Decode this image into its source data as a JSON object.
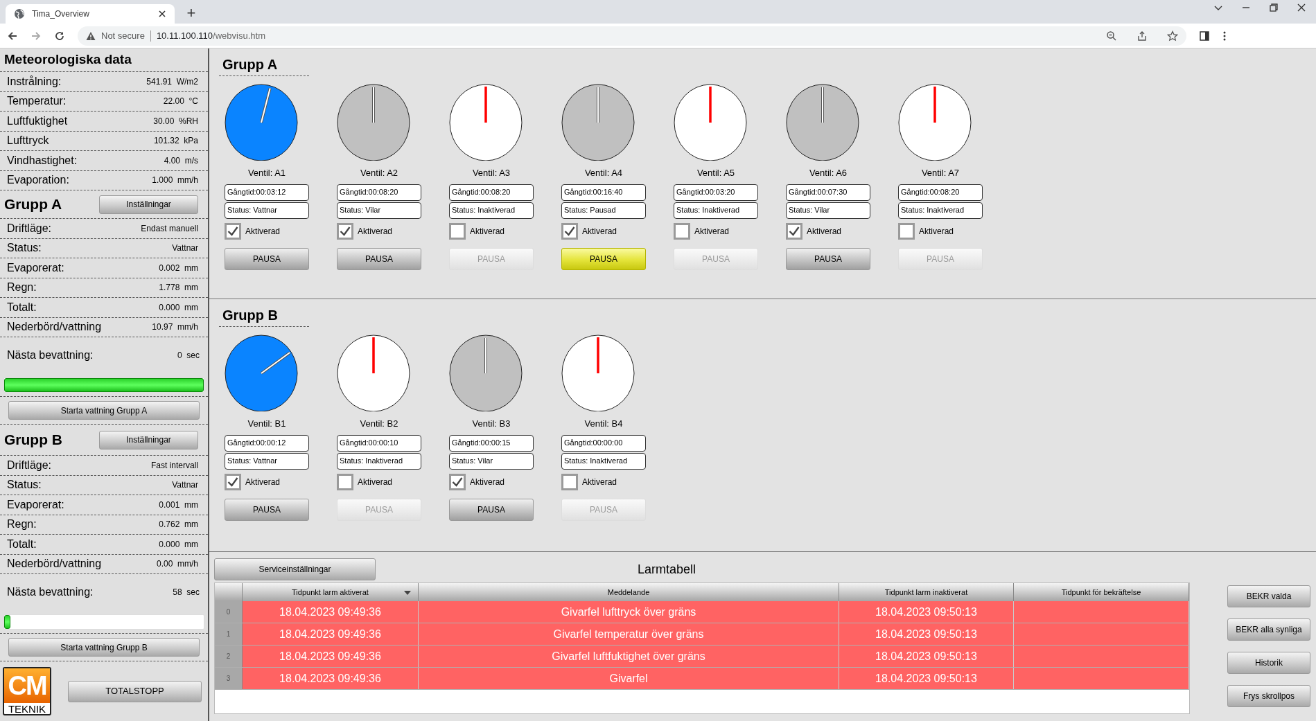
{
  "browser": {
    "tab_title": "Tima_Overview",
    "new_tab": "+",
    "url_warning": "Not secure",
    "url_host": "10.11.100.110",
    "url_path": "/webvisu.htm"
  },
  "sidebar": {
    "title": "Meteorologiska data",
    "meteo": [
      {
        "label": "Instrålning:",
        "value": "541.91",
        "unit": "W/m2"
      },
      {
        "label": "Temperatur:",
        "value": "22.00",
        "unit": "°C"
      },
      {
        "label": "Luftfuktighet",
        "value": "30.00",
        "unit": "%RH"
      },
      {
        "label": "Lufttryck",
        "value": "101.32",
        "unit": "kPa"
      },
      {
        "label": "Vindhastighet:",
        "value": "4.00",
        "unit": "m/s"
      },
      {
        "label": "Evaporation:",
        "value": "1.000",
        "unit": "mm/h"
      }
    ],
    "groups": [
      {
        "title": "Grupp A",
        "settings_button": "Inställningar",
        "rows": [
          {
            "label": "Driftläge:",
            "value": "Endast manuell"
          },
          {
            "label": "Status:",
            "value": "Vattnar"
          },
          {
            "label": "Evaporerat:",
            "value": "0.002",
            "unit": "mm"
          },
          {
            "label": "Regn:",
            "value": "1.778",
            "unit": "mm"
          },
          {
            "label": "Totalt:",
            "value": "0.000",
            "unit": "mm"
          },
          {
            "label": "Nederbörd/vattning",
            "value": "10.97",
            "unit": "mm/h"
          }
        ],
        "next_label": "Nästa bevattning:",
        "next_value": "0",
        "next_unit": "sec",
        "progress": {
          "level": 1
        },
        "start_button": "Starta vattning Grupp A"
      },
      {
        "title": "Grupp B",
        "settings_button": "Inställningar",
        "rows": [
          {
            "label": "Driftläge:",
            "value": "Fast intervall"
          },
          {
            "label": "Status:",
            "value": "Vattnar"
          },
          {
            "label": "Evaporerat:",
            "value": "0.001",
            "unit": "mm"
          },
          {
            "label": "Regn:",
            "value": "0.762",
            "unit": "mm"
          },
          {
            "label": "Totalt:",
            "value": "0.000",
            "unit": "mm"
          },
          {
            "label": "Nederbörd/vattning",
            "value": "0.00",
            "unit": "mm/h"
          }
        ],
        "next_label": "Nästa bevattning:",
        "next_value": "58",
        "next_unit": "sec",
        "progress": {
          "level": 0.03
        },
        "start_button": "Starta vattning Grupp B"
      }
    ],
    "logo": {
      "top": "CM",
      "bottom": "TEKNIK"
    },
    "totalstopp_button": "TOTALSTOPP"
  },
  "main": {
    "groups": [
      {
        "title": "Grupp A",
        "valves": [
          {
            "kind": "running",
            "level": 0.04,
            "name": "Ventil: A1",
            "runtime": "Gångtid:00:03:12",
            "status": "Status: Vattnar",
            "checked": true,
            "checkbox_label": "Aktiverad",
            "pause_label": "PAUSA",
            "pause_disabled": false,
            "paused": false
          },
          {
            "kind": "idle",
            "name": "Ventil: A2",
            "runtime": "Gångtid:00:08:20",
            "status": "Status: Vilar",
            "checked": true,
            "checkbox_label": "Aktiverad",
            "pause_label": "PAUSA",
            "pause_disabled": false,
            "paused": false
          },
          {
            "kind": "inactive",
            "name": "Ventil: A3",
            "runtime": "Gångtid:00:08:20",
            "status": "Status: Inaktiverad",
            "checked": false,
            "checkbox_label": "Aktiverad",
            "pause_label": "PAUSA",
            "pause_disabled": true,
            "paused": false
          },
          {
            "kind": "idle",
            "name": "Ventil: A4",
            "runtime": "Gångtid:00:16:40",
            "status": "Status: Pausad",
            "checked": true,
            "checkbox_label": "Aktiverad",
            "pause_label": "PAUSA",
            "pause_disabled": false,
            "paused": true
          },
          {
            "kind": "inactive",
            "name": "Ventil: A5",
            "runtime": "Gångtid:00:03:20",
            "status": "Status: Inaktiverad",
            "checked": false,
            "checkbox_label": "Aktiverad",
            "pause_label": "PAUSA",
            "pause_disabled": true,
            "paused": false
          },
          {
            "kind": "idle",
            "name": "Ventil: A6",
            "runtime": "Gångtid:00:07:30",
            "status": "Status: Vilar",
            "checked": true,
            "checkbox_label": "Aktiverad",
            "pause_label": "PAUSA",
            "pause_disabled": false,
            "paused": false
          },
          {
            "kind": "inactive",
            "name": "Ventil: A7",
            "runtime": "Gångtid:00:08:20",
            "status": "Status: Inaktiverad",
            "checked": false,
            "checkbox_label": "Aktiverad",
            "pause_label": "PAUSA",
            "pause_disabled": true,
            "paused": false
          }
        ]
      },
      {
        "title": "Grupp B",
        "valves": [
          {
            "kind": "running",
            "level": 0.15,
            "name": "Ventil: B1",
            "runtime": "Gångtid:00:00:12",
            "status": "Status: Vattnar",
            "checked": true,
            "checkbox_label": "Aktiverad",
            "pause_label": "PAUSA",
            "pause_disabled": false,
            "paused": false
          },
          {
            "kind": "inactive",
            "name": "Ventil: B2",
            "runtime": "Gångtid:00:00:10",
            "status": "Status: Inaktiverad",
            "checked": false,
            "checkbox_label": "Aktiverad",
            "pause_label": "PAUSA",
            "pause_disabled": true,
            "paused": false
          },
          {
            "kind": "idle",
            "name": "Ventil: B3",
            "runtime": "Gångtid:00:00:15",
            "status": "Status: Vilar",
            "checked": true,
            "checkbox_label": "Aktiverad",
            "pause_label": "PAUSA",
            "pause_disabled": false,
            "paused": false
          },
          {
            "kind": "inactive",
            "name": "Ventil: B4",
            "runtime": "Gångtid:00:00:00",
            "status": "Status: Inaktiverad",
            "checked": false,
            "checkbox_label": "Aktiverad",
            "pause_label": "PAUSA",
            "pause_disabled": true,
            "paused": false
          }
        ]
      }
    ]
  },
  "alarms": {
    "service_button": "Serviceinställningar",
    "title": "Larmtabell",
    "columns": [
      {
        "label": "Tidpunkt larm aktiverat",
        "sorted": true
      },
      {
        "label": "Meddelande",
        "sorted": false
      },
      {
        "label": "Tidpunkt larm inaktiverat",
        "sorted": false
      },
      {
        "label": "Tidpunkt för bekräftelse",
        "sorted": false
      }
    ],
    "rows": [
      {
        "index": "0",
        "cells": [
          "18.04.2023 09:49:36",
          "Givarfel lufttryck över gräns",
          "18.04.2023 09:50:13"
        ]
      },
      {
        "index": "1",
        "cells": [
          "18.04.2023 09:49:36",
          "Givarfel temperatur över gräns",
          "18.04.2023 09:50:13"
        ]
      },
      {
        "index": "2",
        "cells": [
          "18.04.2023 09:49:36",
          "Givarfel luftfuktighet över gräns",
          "18.04.2023 09:50:13"
        ]
      },
      {
        "index": "3",
        "cells": [
          "18.04.2023 09:49:36",
          "Givarfel",
          "18.04.2023 09:50:13"
        ]
      }
    ],
    "buttons": [
      "BEKR valda",
      "BEKR alla synliga",
      "Historik",
      "Frys skrollpos"
    ]
  }
}
